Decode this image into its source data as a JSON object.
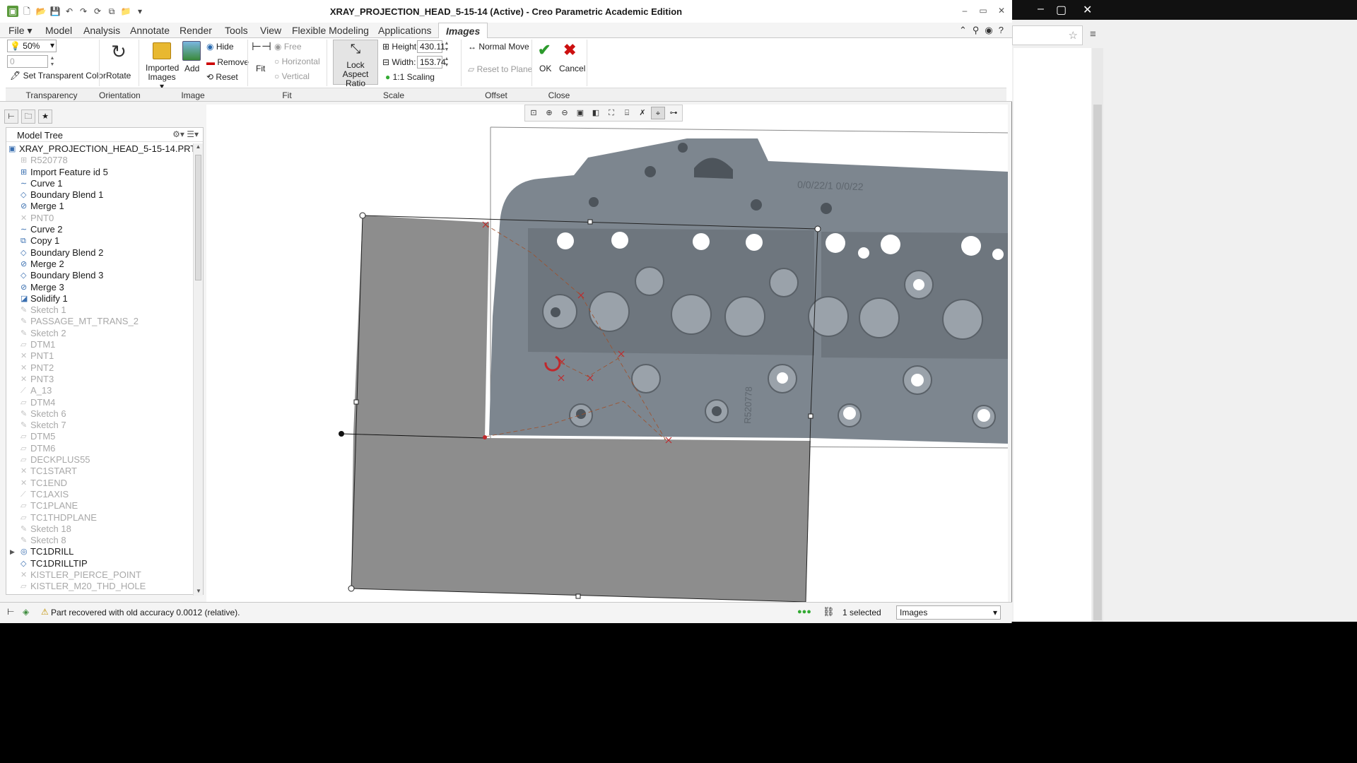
{
  "window": {
    "title": "XRAY_PROJECTION_HEAD_5-15-14 (Active) - Creo Parametric Academic Edition"
  },
  "tabs": [
    "File",
    "Model",
    "Analysis",
    "Annotate",
    "Render",
    "Tools",
    "View",
    "Flexible Modeling",
    "Applications",
    "Images"
  ],
  "ribbon": {
    "transparency": {
      "percent": "50%",
      "value": "0",
      "set_color_label": "Set Transparent Color",
      "group_label": "Transparency"
    },
    "orientation": {
      "rotate_label": "Rotate",
      "group_label": "Orientation"
    },
    "image": {
      "imported_label": "Imported",
      "imported_label2": "Images",
      "add_label": "Add",
      "hide_label": "Hide",
      "remove_label": "Remove",
      "reset_label": "Reset",
      "group_label": "Image"
    },
    "fit": {
      "fit_label": "Fit",
      "free_label": "Free",
      "horizontal_label": "Horizontal",
      "vertical_label": "Vertical",
      "group_label": "Fit"
    },
    "scale": {
      "lock_label": "Lock Aspect",
      "lock_label2": "Ratio",
      "height_label": "Height:",
      "height_value": "430.11",
      "width_label": "Width:",
      "width_value": "153.74",
      "one_to_one_label": "1:1 Scaling",
      "group_label": "Scale"
    },
    "offset": {
      "normal_move_label": "Normal Move",
      "reset_plane_label": "Reset to Plane",
      "group_label": "Offset"
    },
    "close": {
      "ok_label": "OK",
      "cancel_label": "Cancel",
      "group_label": "Close"
    }
  },
  "model_tree": {
    "header": "Model Tree",
    "items": [
      {
        "label": "XRAY_PROJECTION_HEAD_5-15-14.PRT",
        "dim": false,
        "icon": "part-icon"
      },
      {
        "label": "R520778",
        "dim": true,
        "icon": "import-icon"
      },
      {
        "label": "Import Feature id 5",
        "dim": false,
        "icon": "import-icon"
      },
      {
        "label": "Curve 1",
        "dim": false,
        "icon": "curve-icon"
      },
      {
        "label": "Boundary Blend 1",
        "dim": false,
        "icon": "blend-icon"
      },
      {
        "label": "Merge 1",
        "dim": false,
        "icon": "merge-icon"
      },
      {
        "label": "PNT0",
        "dim": true,
        "icon": "point-icon"
      },
      {
        "label": "Curve 2",
        "dim": false,
        "icon": "curve-icon"
      },
      {
        "label": "Copy 1",
        "dim": false,
        "icon": "copy-icon"
      },
      {
        "label": "Boundary Blend 2",
        "dim": false,
        "icon": "blend-icon"
      },
      {
        "label": "Merge 2",
        "dim": false,
        "icon": "merge-icon"
      },
      {
        "label": "Boundary Blend 3",
        "dim": false,
        "icon": "blend-icon"
      },
      {
        "label": "Merge 3",
        "dim": false,
        "icon": "merge-icon"
      },
      {
        "label": "Solidify 1",
        "dim": false,
        "icon": "solidify-icon"
      },
      {
        "label": "Sketch 1",
        "dim": true,
        "icon": "sketch-icon"
      },
      {
        "label": "PASSAGE_MT_TRANS_2",
        "dim": true,
        "icon": "sketch-icon"
      },
      {
        "label": "Sketch 2",
        "dim": true,
        "icon": "sketch-icon"
      },
      {
        "label": "DTM1",
        "dim": true,
        "icon": "datum-icon"
      },
      {
        "label": "PNT1",
        "dim": true,
        "icon": "point-icon"
      },
      {
        "label": "PNT2",
        "dim": true,
        "icon": "point-icon"
      },
      {
        "label": "PNT3",
        "dim": true,
        "icon": "point-icon"
      },
      {
        "label": "A_13",
        "dim": true,
        "icon": "axis-icon"
      },
      {
        "label": "DTM4",
        "dim": true,
        "icon": "datum-icon"
      },
      {
        "label": "Sketch 6",
        "dim": true,
        "icon": "sketch-icon"
      },
      {
        "label": "Sketch 7",
        "dim": true,
        "icon": "sketch-icon"
      },
      {
        "label": "DTM5",
        "dim": true,
        "icon": "datum-icon"
      },
      {
        "label": "DTM6",
        "dim": true,
        "icon": "datum-icon"
      },
      {
        "label": "DECKPLUS55",
        "dim": true,
        "icon": "datum-icon"
      },
      {
        "label": "TC1START",
        "dim": true,
        "icon": "point-icon"
      },
      {
        "label": "TC1END",
        "dim": true,
        "icon": "point-icon"
      },
      {
        "label": "TC1AXIS",
        "dim": true,
        "icon": "axis-icon"
      },
      {
        "label": "TC1PLANE",
        "dim": true,
        "icon": "datum-icon"
      },
      {
        "label": "TC1THDPLANE",
        "dim": true,
        "icon": "datum-icon"
      },
      {
        "label": "Sketch 18",
        "dim": true,
        "icon": "sketch-icon"
      },
      {
        "label": "Sketch 8",
        "dim": true,
        "icon": "sketch-icon"
      },
      {
        "label": "TC1DRILL",
        "dim": false,
        "icon": "hole-icon",
        "expandable": true
      },
      {
        "label": "TC1DRILLTIP",
        "dim": false,
        "icon": "blend-icon"
      },
      {
        "label": "KISTLER_PIERCE_POINT",
        "dim": true,
        "icon": "point-icon"
      },
      {
        "label": "KISTLER_M20_THD_HOLE",
        "dim": true,
        "icon": "datum-icon"
      }
    ]
  },
  "graphics": {
    "engraving_1": "0/0/22/1  0/0/22",
    "engraving_2": "R520778"
  },
  "status": {
    "message": "Part recovered with old accuracy 0.0012 (relative).",
    "selected": "1 selected",
    "filter": "Images"
  }
}
